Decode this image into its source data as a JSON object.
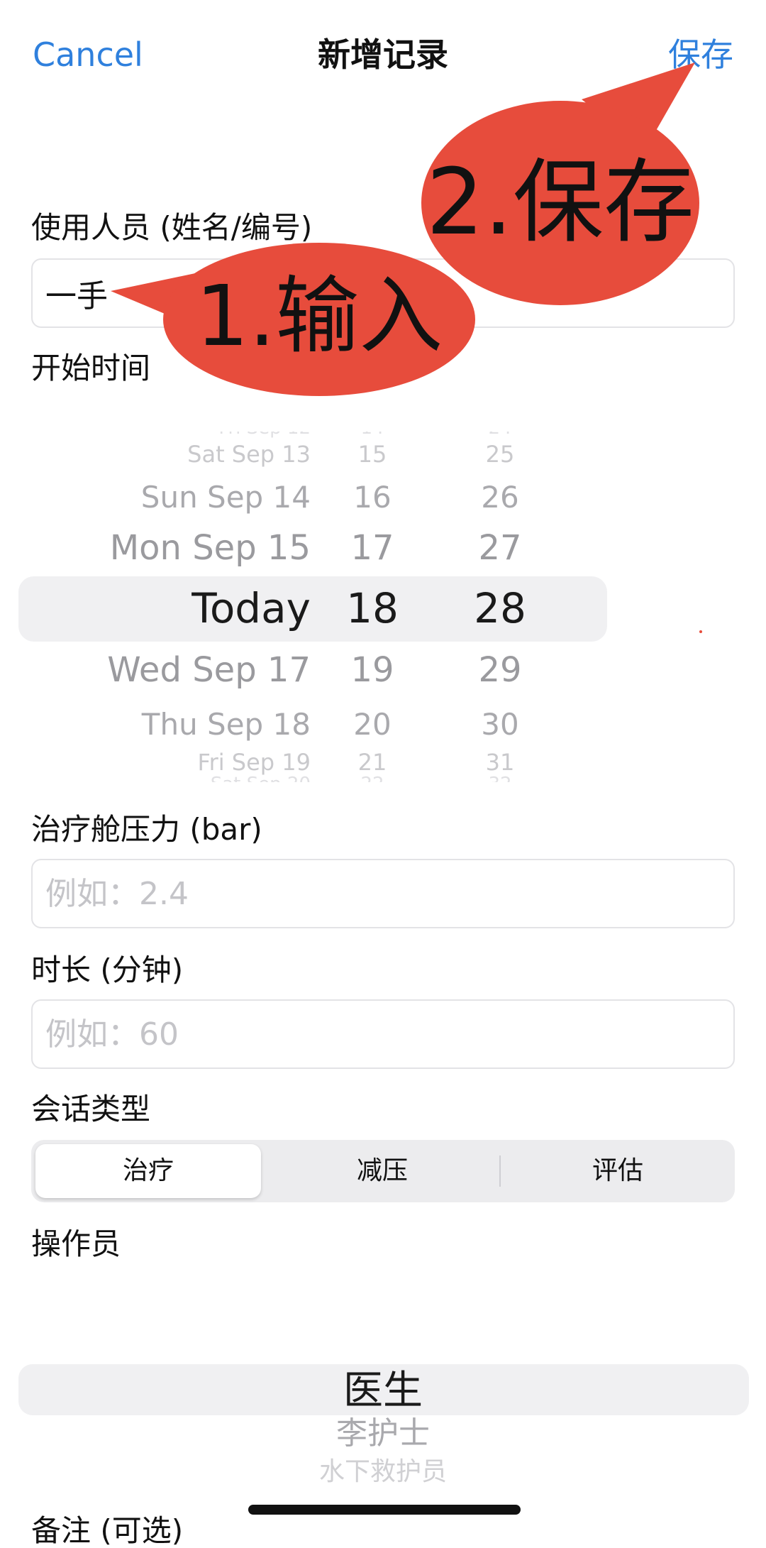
{
  "nav": {
    "cancel": "Cancel",
    "title": "新增记录",
    "save": "保存"
  },
  "user": {
    "label": "使用人员 (姓名/编号)",
    "value": "一手"
  },
  "start_time": {
    "label": "开始时间",
    "rows": [
      {
        "date": "Sat Sep 13",
        "hour": "15",
        "minute": "25"
      },
      {
        "date": "Sun Sep 14",
        "hour": "16",
        "minute": "26"
      },
      {
        "date": "Mon Sep 15",
        "hour": "17",
        "minute": "27"
      },
      {
        "date": "Today",
        "hour": "18",
        "minute": "28"
      },
      {
        "date": "Wed Sep 17",
        "hour": "19",
        "minute": "29"
      },
      {
        "date": "Thu Sep 18",
        "hour": "20",
        "minute": "30"
      },
      {
        "date": "Fri Sep 19",
        "hour": "21",
        "minute": "31"
      }
    ]
  },
  "pressure": {
    "label": "治疗舱压力 (bar)",
    "placeholder": "例如：2.4"
  },
  "duration": {
    "label": "时长 (分钟)",
    "placeholder": "例如：60"
  },
  "session_type": {
    "label": "会话类型",
    "options": [
      "治疗",
      "减压",
      "评估"
    ],
    "selected": "治疗"
  },
  "operator": {
    "label": "操作员",
    "options": [
      "医生",
      "李护士",
      "水下救护员"
    ],
    "selected": "医生"
  },
  "notes": {
    "label": "备注 (可选)"
  },
  "annotations": {
    "step1": "1.输入",
    "step2": "2.保存",
    "color": "#e74c3c"
  },
  "colors": {
    "accent": "#2f80dd",
    "field_border": "#e3e3e6",
    "picker_highlight": "#f0f0f2"
  }
}
